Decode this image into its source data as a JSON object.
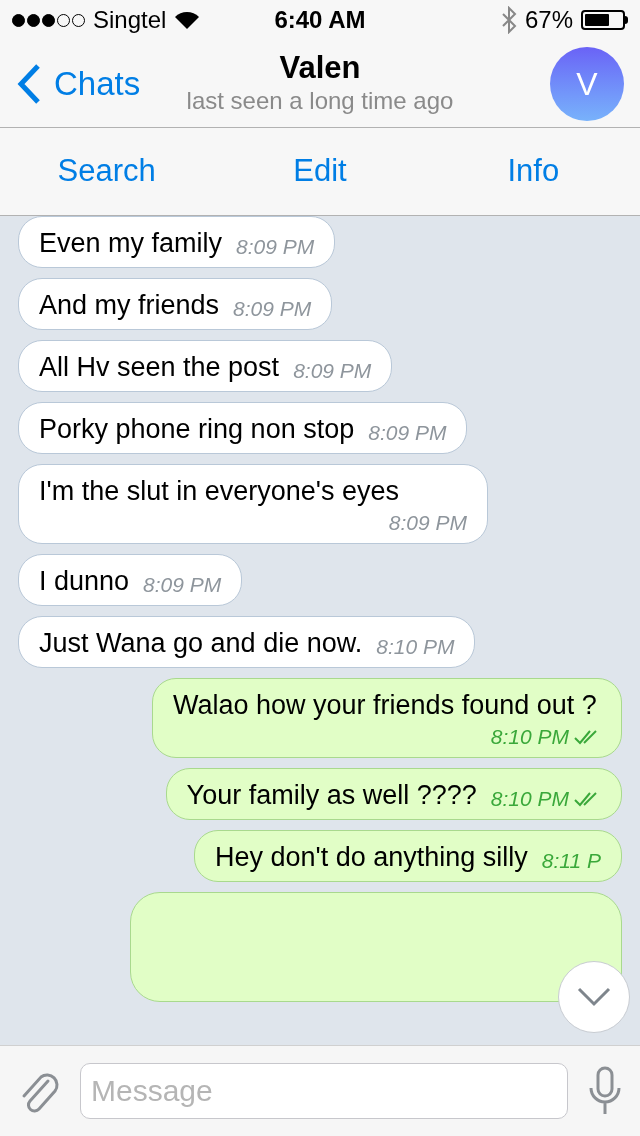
{
  "status_bar": {
    "carrier": "Singtel",
    "time": "6:40 AM",
    "battery_percent": "67%"
  },
  "header": {
    "back_label": "Chats",
    "title": "Valen",
    "subtitle": "last seen a long time ago",
    "avatar_letter": "V"
  },
  "toolbar": [
    "Search",
    "Edit",
    "Info"
  ],
  "messages": [
    {
      "kind": "incoming",
      "text": "Even my family",
      "time": "8:09 PM"
    },
    {
      "kind": "incoming",
      "text": "And my friends",
      "time": "8:09 PM"
    },
    {
      "kind": "incoming",
      "text": "All Hv seen the post",
      "time": "8:09 PM"
    },
    {
      "kind": "incoming",
      "text": "Porky phone ring non stop",
      "time": "8:09 PM"
    },
    {
      "kind": "incoming",
      "text": "I'm the slut in everyone's eyes",
      "time": "8:09 PM"
    },
    {
      "kind": "incoming",
      "text": "I dunno",
      "time": "8:09 PM"
    },
    {
      "kind": "incoming",
      "text": "Just Wana go and die now.",
      "time": "8:10 PM"
    },
    {
      "kind": "outgoing",
      "text": "Walao how your friends found out ?",
      "time": "8:10 PM",
      "read": true
    },
    {
      "kind": "outgoing",
      "text": "Your family as well ????",
      "time": "8:10 PM",
      "read": true
    },
    {
      "kind": "outgoing",
      "text": "Hey don't do anything silly",
      "time": "8:11 P"
    },
    {
      "kind": "outgoing"
    }
  ],
  "composer": {
    "placeholder": "Message"
  }
}
